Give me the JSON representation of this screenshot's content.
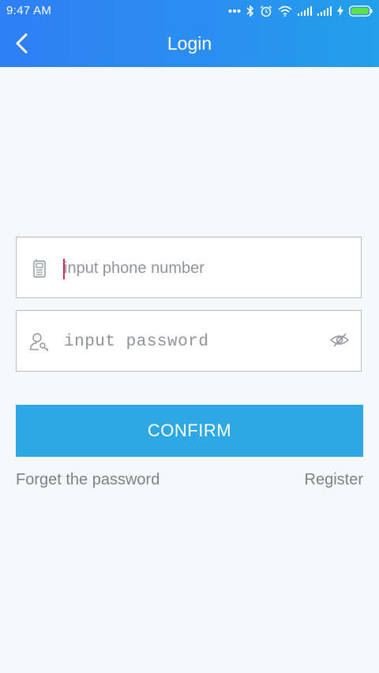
{
  "status_bar": {
    "time": "9:47 AM",
    "icons": [
      "more-dots-icon",
      "bluetooth-icon",
      "alarm-icon",
      "wifi-icon",
      "signal-icon",
      "signal-icon",
      "charging-icon",
      "battery-icon"
    ]
  },
  "app_bar": {
    "title": "Login",
    "back_icon": "chevron-left-icon"
  },
  "form": {
    "phone": {
      "icon": "mobile-phone-icon",
      "value": "",
      "placeholder": "input phone number"
    },
    "password": {
      "icon": "user-key-icon",
      "value": "",
      "placeholder": "input password",
      "toggle_icon": "eye-hidden-icon"
    },
    "confirm_label": "CONFIRM",
    "forget_label": "Forget the password",
    "register_label": "Register"
  },
  "colors": {
    "header_start": "#2f7ff4",
    "header_end": "#22a0ea",
    "button": "#2ea7e5",
    "cursor": "#d3245c",
    "link_text": "#7c8187"
  }
}
